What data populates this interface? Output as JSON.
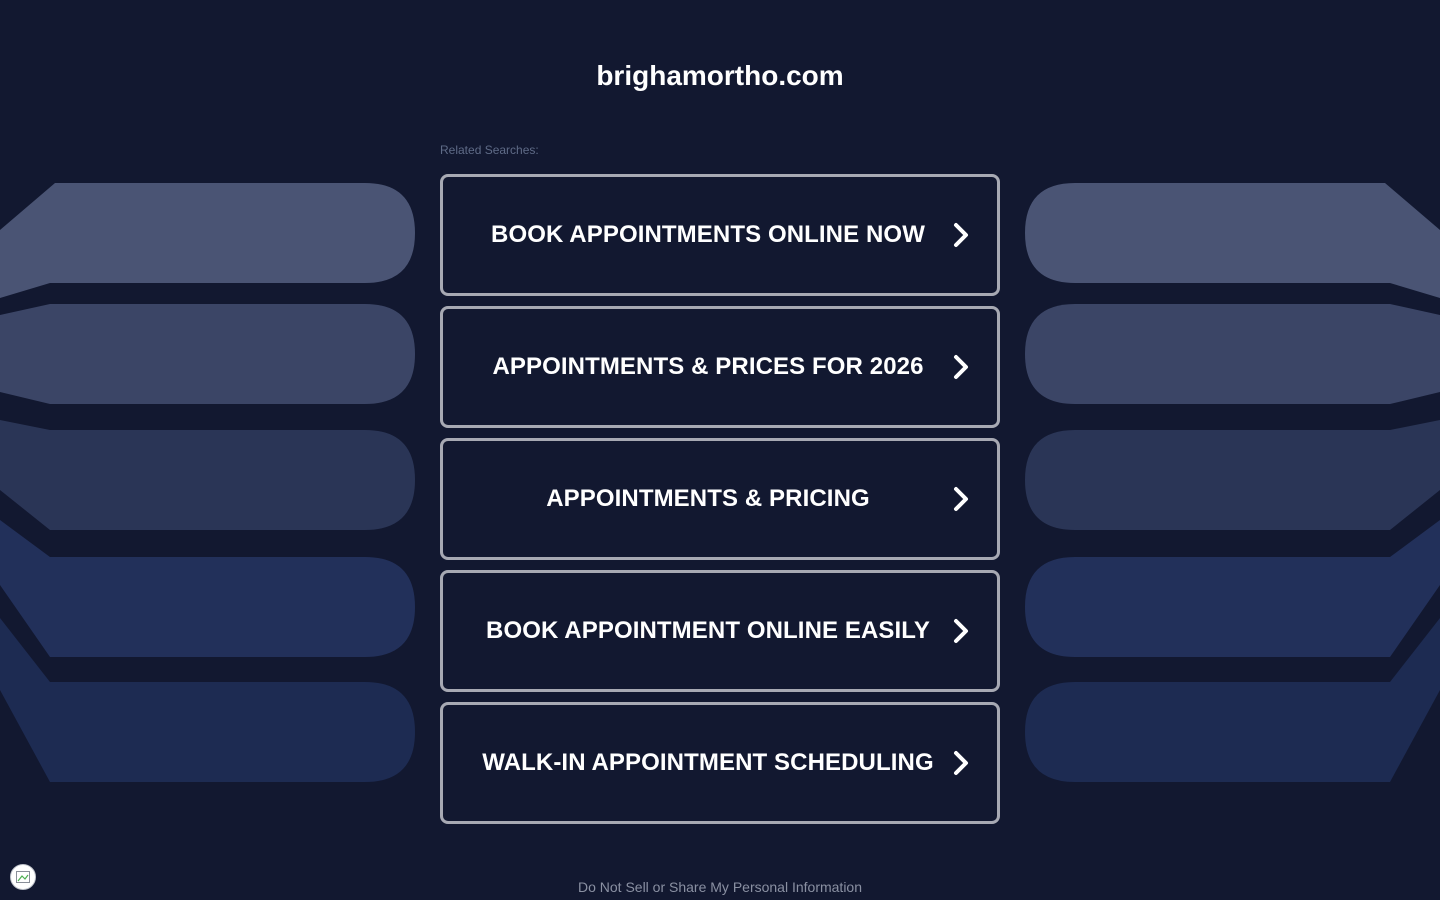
{
  "site": {
    "title": "brighamortho.com"
  },
  "related": {
    "label": "Related Searches:",
    "items": [
      {
        "label": "BOOK APPOINTMENTS ONLINE NOW"
      },
      {
        "label": "APPOINTMENTS & PRICES FOR 2026"
      },
      {
        "label": "APPOINTMENTS & PRICING"
      },
      {
        "label": "BOOK APPOINTMENT ONLINE EASILY"
      },
      {
        "label": "WALK-IN APPOINTMENT SCHEDULING"
      }
    ]
  },
  "footer": {
    "privacy_link": "Do Not Sell or Share My Personal Information"
  },
  "icons": {
    "chevron": "chevron-right-icon",
    "privacy": "privacy-settings-icon"
  },
  "colors": {
    "background": "#121830",
    "button_border": "#a7a9b3",
    "text": "#ffffff",
    "muted_text": "#5f6b87",
    "footer_text": "#8a90a2",
    "decor_light": "#4a5474",
    "decor_mid": "#3b4566",
    "decor_dark": "#2a3556",
    "decor_darker": "#22305a",
    "decor_darkest": "#1d2b52"
  }
}
